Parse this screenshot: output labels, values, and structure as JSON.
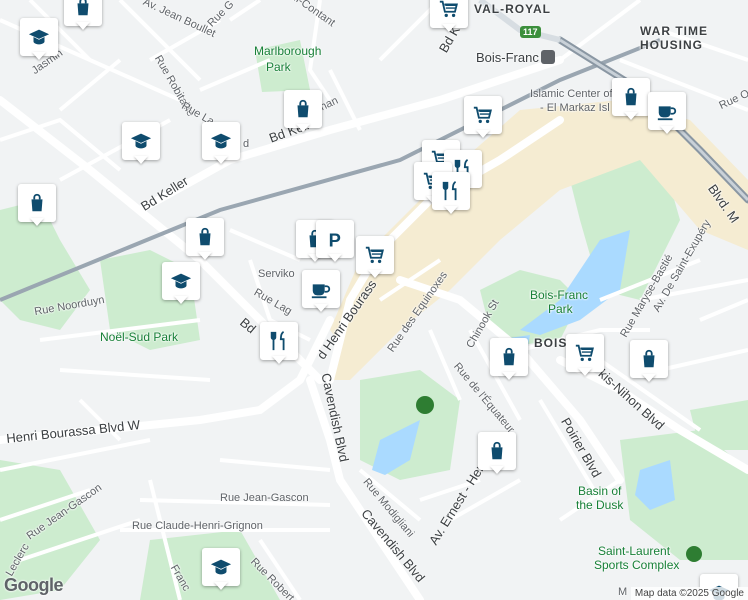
{
  "map": {
    "attribution": "Map data ©2025 Google",
    "logo": "Google",
    "areas": {
      "val_royal": "VAL-ROYAL",
      "war_time_line1": "WAR TIME",
      "war_time_line2": "HOUSING",
      "bois_franc_district": "BOIS-FR"
    },
    "parks": {
      "marlborough_line1": "Marlborough",
      "marlborough_line2": "Park",
      "noel_sud": "Noël-Sud Park",
      "bois_franc_line1": "Bois-Franc",
      "bois_franc_line2": "Park",
      "basin_line1": "Basin of",
      "basin_line2": "the Dusk"
    },
    "places": {
      "bois_franc_station": "Bois-Franc",
      "islamic_center_line1": "Islamic Center of Qu",
      "islamic_center_line2": "- El Markaz Isl",
      "serviko": "Serviko",
      "sports_complex_line1": "Saint-Laurent",
      "sports_complex_line2": "Sports Complex",
      "bottom_right_partial": "M"
    },
    "highway_shield": "117",
    "streets": {
      "jean_boullet": "Av. Jean Boullet",
      "rue_g": "Rue G",
      "paul_contant": "aul-Contant",
      "jasmin": "Jasmin",
      "robitaille": "Rue Robitaille",
      "rue_la": "Rue La",
      "rue_d": "d",
      "nan": "nan",
      "keller_1": "Bd Keller",
      "keller_2": "Bd Keller",
      "keller_top": "Bd Kell",
      "oxf": "Rue Oxf",
      "blvd_m": "Blvd. M",
      "saint_exupery": "Av. De Saint-Exupéry",
      "maryse_bastie": "Rue Maryse-Bastié",
      "noorduyn": "Rue Noorduyn",
      "lag": "Rue Lag",
      "henri_bourassa_diag": "d Henri Bourass",
      "bd_short": "Bd",
      "henri_bourassa_w": "Henri Bourassa Blvd W",
      "cavendish_1": "Cavendish Blvd",
      "cavendish_2": "Cavendish Blvd",
      "equinoxes": "Rue des Equinoxes",
      "chinook": "Chinook St",
      "equateur": "Rue de l'Équateur",
      "kis_nihon": "kis-Nihon Blvd",
      "poirier": "Poirier Blvd",
      "ernest_hen": "Av. Ernest - Hen",
      "modigliani": "Rue Modigliani",
      "jean_gascon_1": "Rue Jean-Gascon",
      "jean_gascon_2": "Rue Jean-Gascon",
      "claude_henri": "Rue Claude-Henri-Grignon",
      "leclerc": "Leclerc",
      "franc": "Franc",
      "robert": "Rue Robert"
    },
    "markers": [
      {
        "icon": "education-icon"
      },
      {
        "icon": "shopping-bag-icon"
      },
      {
        "icon": "shopping-cart-icon"
      },
      {
        "icon": "train-station-icon"
      },
      {
        "icon": "shopping-bag-icon"
      },
      {
        "icon": "education-icon"
      },
      {
        "icon": "education-icon"
      },
      {
        "icon": "shopping-cart-icon"
      },
      {
        "icon": "shopping-bag-icon"
      },
      {
        "icon": "cafe-icon"
      },
      {
        "icon": "shopping-bag-icon"
      },
      {
        "icon": "shopping-bag-icon"
      },
      {
        "icon": "education-icon"
      },
      {
        "icon": "shopping-cart-icon"
      },
      {
        "icon": "restaurant-icon"
      },
      {
        "icon": "shopping-cart-icon"
      },
      {
        "icon": "restaurant-icon"
      },
      {
        "icon": "shopping-bag-icon"
      },
      {
        "icon": "parking-icon"
      },
      {
        "icon": "shopping-cart-icon"
      },
      {
        "icon": "cafe-icon"
      },
      {
        "icon": "restaurant-icon"
      },
      {
        "icon": "shopping-bag-icon"
      },
      {
        "icon": "shopping-cart-icon"
      },
      {
        "icon": "shopping-bag-icon"
      },
      {
        "icon": "shopping-bag-icon"
      },
      {
        "icon": "education-icon"
      },
      {
        "icon": "education-icon"
      }
    ],
    "colors": {
      "marker_icon": "#0f4c6e",
      "park": "#c8e6c9",
      "water": "#aadaff",
      "highway": "#fdd663",
      "rail": "#8a97a3",
      "commercial": "#f4ebd0"
    }
  }
}
